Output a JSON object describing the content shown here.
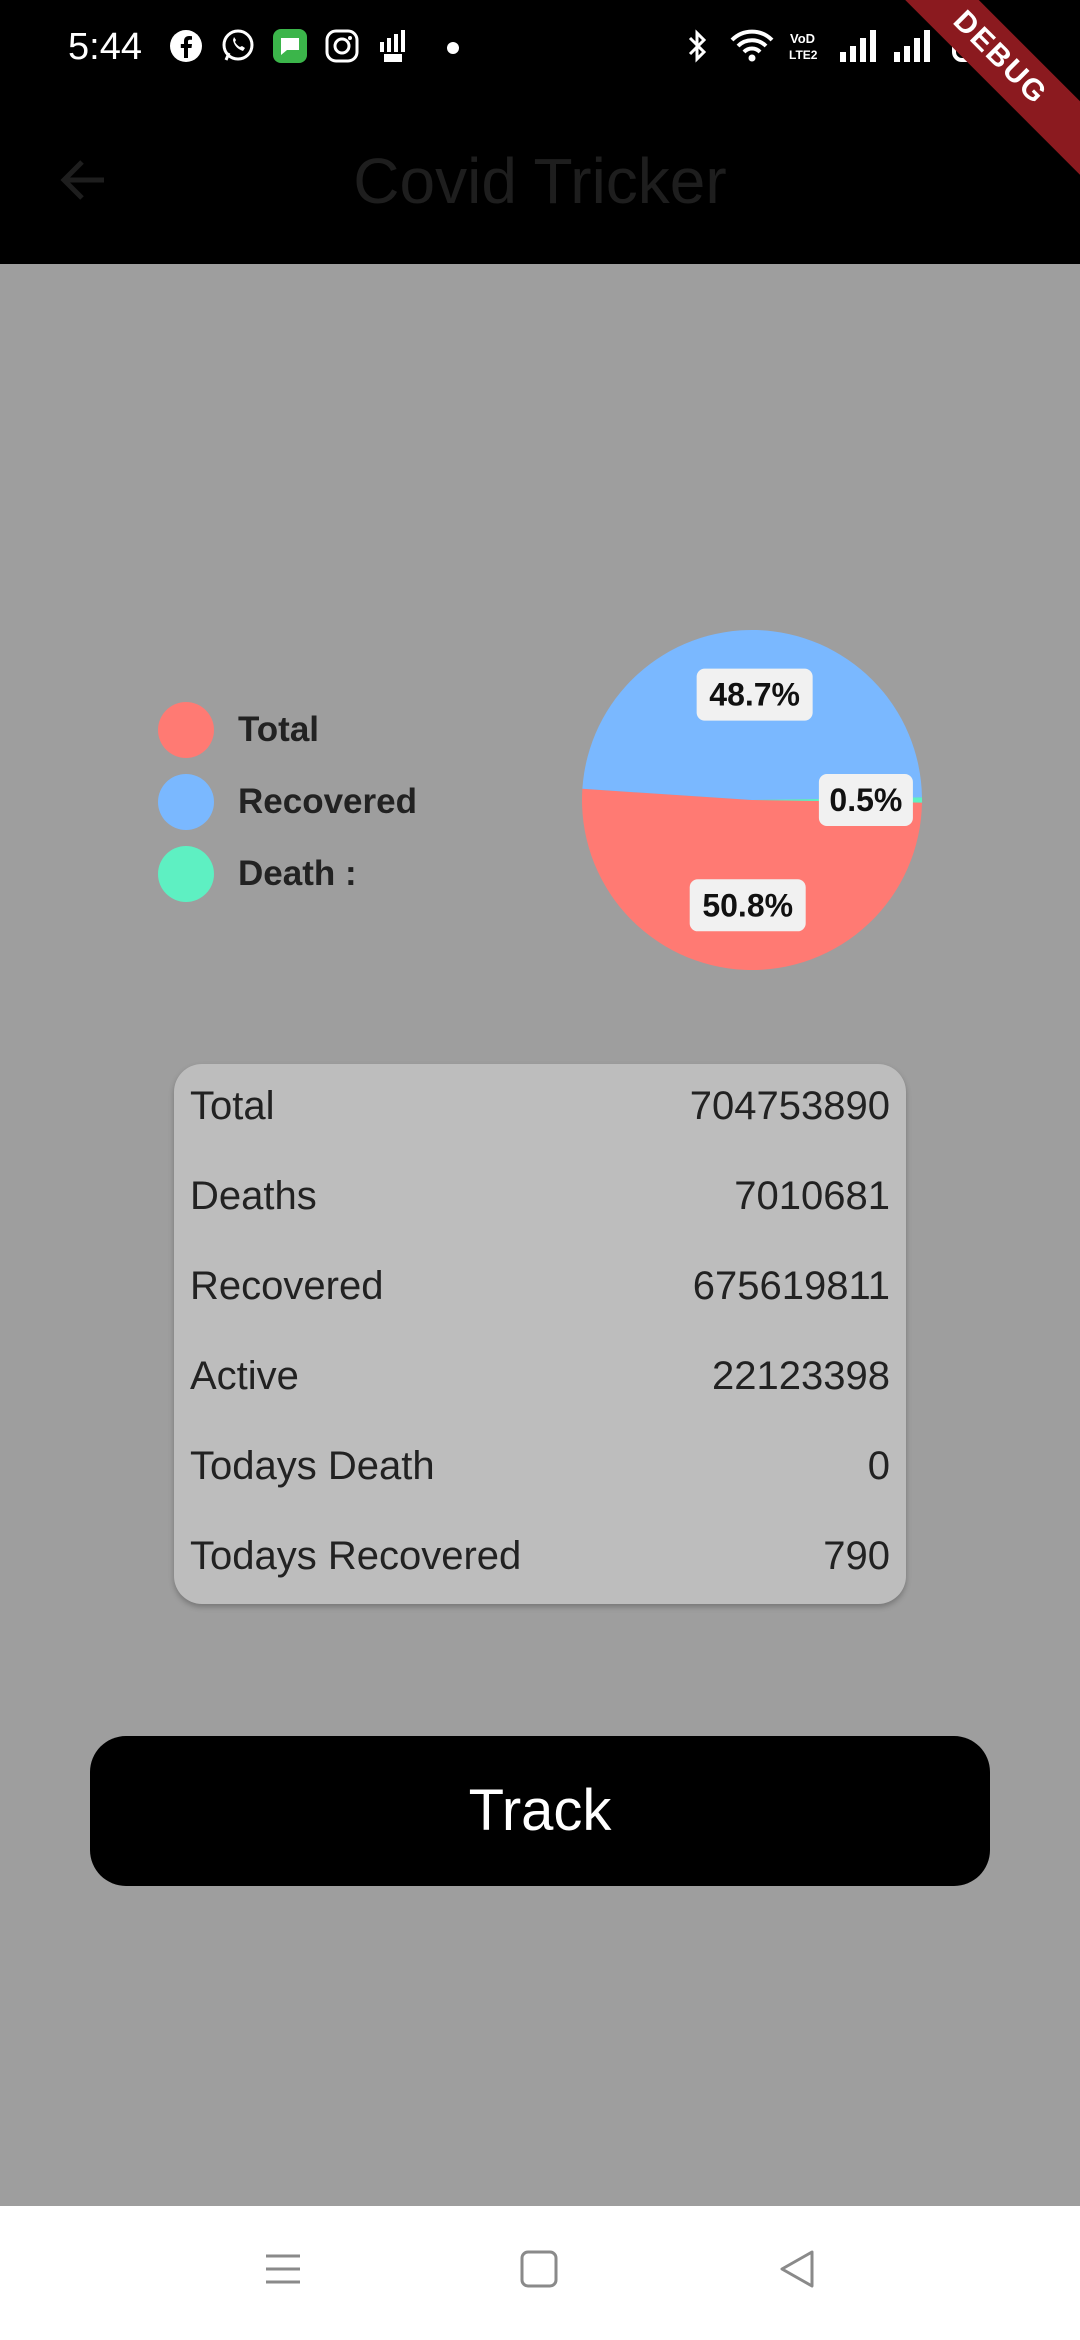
{
  "status_bar": {
    "time": "5:44",
    "left_icons": [
      "facebook-icon",
      "whatsapp-icon",
      "messages-icon",
      "instagram-icon",
      "signal-bars-icon"
    ],
    "right_icons": [
      "bluetooth-icon",
      "wifi-icon",
      "volte-icon",
      "signal-icon",
      "signal-icon",
      "battery-icon"
    ]
  },
  "app_bar": {
    "title": "Covid Tricker",
    "back_icon": "arrow-left-icon"
  },
  "debug_banner": "DEBUG",
  "legend": [
    {
      "label": "Total",
      "color": "#ff7a73"
    },
    {
      "label": "Recovered",
      "color": "#7ab8ff"
    },
    {
      "label": "Death :",
      "color": "#5ef0c2"
    }
  ],
  "chart_data": {
    "type": "pie",
    "slices": [
      {
        "name": "Total",
        "value": 50.8,
        "label": "50.8%",
        "color": "#ff7a73"
      },
      {
        "name": "Recovered",
        "value": 48.7,
        "label": "48.7%",
        "color": "#7ab8ff"
      },
      {
        "name": "Death :",
        "value": 0.5,
        "label": "0.5%",
        "color": "#5ef0c2"
      }
    ]
  },
  "stats": [
    {
      "label": "Total",
      "value": "704753890"
    },
    {
      "label": "Deaths",
      "value": "7010681"
    },
    {
      "label": "Recovered",
      "value": "675619811"
    },
    {
      "label": "Active",
      "value": "22123398"
    },
    {
      "label": "Todays Death",
      "value": "0"
    },
    {
      "label": "Todays Recovered",
      "value": "790"
    }
  ],
  "track_button": {
    "label": "Track"
  },
  "nav_bar": {
    "icons": [
      "menu-icon",
      "home-icon",
      "back-triangle-icon"
    ]
  }
}
